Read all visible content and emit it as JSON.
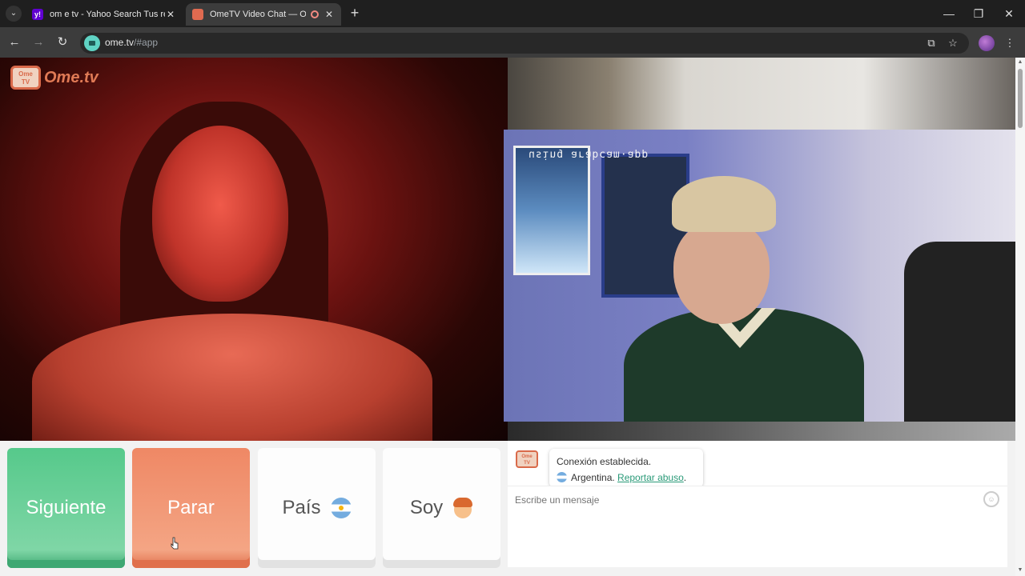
{
  "browser": {
    "tabs": [
      {
        "title": "om e tv - Yahoo Search Tus resu",
        "favicon": "yahoo-icon",
        "favicon_letter": "y!",
        "close": "✕"
      },
      {
        "title": "OmeTV Video Chat — Ome",
        "favicon": "ometv-icon",
        "recording": true,
        "close": "✕"
      }
    ],
    "new_tab": "+",
    "window_controls": {
      "minimize": "—",
      "restore": "❐",
      "close": "✕"
    },
    "nav": {
      "back": "←",
      "forward": "→",
      "reload": "↻"
    },
    "url": {
      "host": "ome.tv",
      "path": "/#app"
    },
    "toolbar_icons": {
      "cast": "⧉",
      "bookmark": "☆",
      "menu": "⋮"
    }
  },
  "page": {
    "logo": {
      "badge_line1": "Ome",
      "badge_line2": "TV",
      "text": "Ome.tv"
    },
    "pip_overlay_text": "ddɐ·ɯɐɔqɐɹɐ ɓuᴉsn",
    "controls": {
      "next_label": "Siguiente",
      "stop_label": "Parar",
      "country_label": "País",
      "gender_label": "Soy"
    },
    "chat": {
      "avatar_line1": "Ome",
      "avatar_line2": "TV",
      "status": "Conexión establecida.",
      "country": "Argentina.",
      "report_link": "Reportar abuso",
      "report_suffix": ".",
      "input_placeholder": "Escribe un mensaje",
      "emoji_button": "☺"
    },
    "scroll": {
      "up": "▲",
      "down": "▼"
    }
  },
  "colors": {
    "next": "#56c98b",
    "stop": "#ef8865",
    "link": "#2a9a78",
    "brand": "#e07a55"
  }
}
